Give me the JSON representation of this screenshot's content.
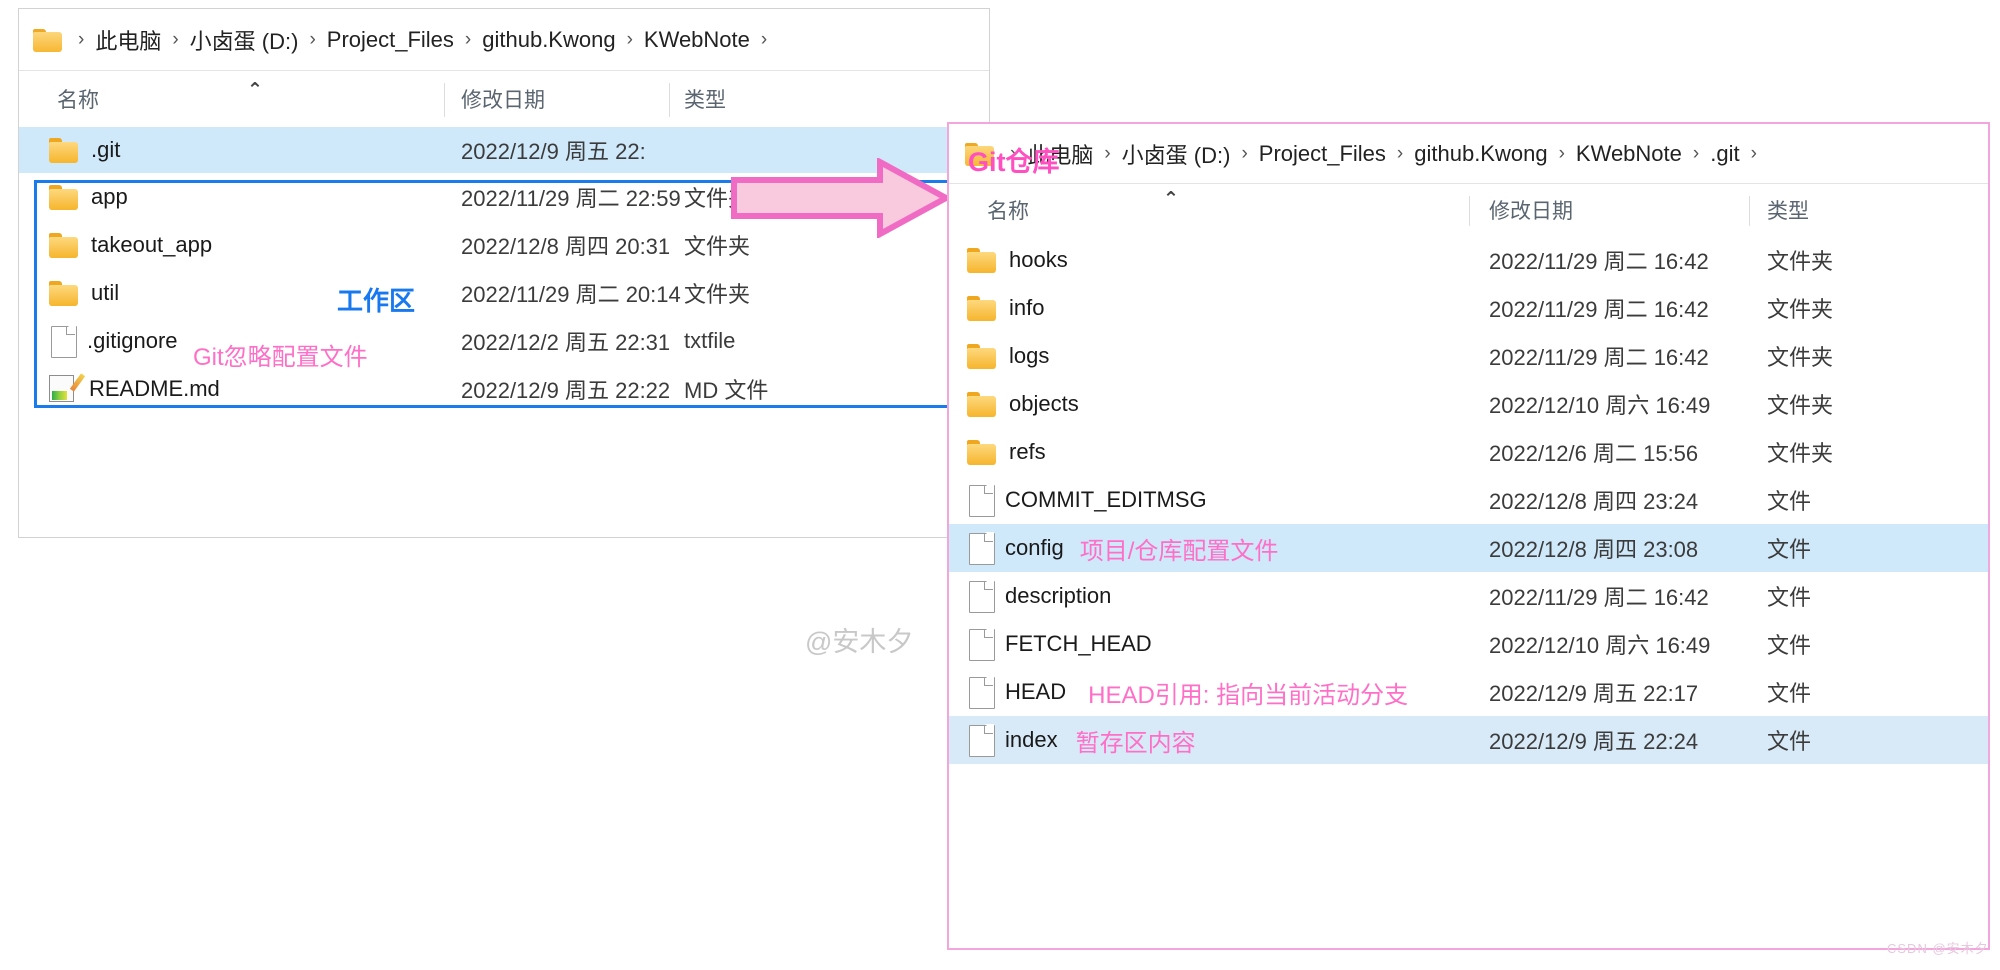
{
  "left_window": {
    "breadcrumb": {
      "folder_icon": "folder-icon",
      "items": [
        "此电脑",
        "小卤蛋 (D:)",
        "Project_Files",
        "github.Kwong",
        "KWebNote"
      ],
      "separator": "›",
      "trailing_separator": "›"
    },
    "columns": {
      "name": "名称",
      "date": "修改日期",
      "type": "类型",
      "sort_caret": "⌃"
    },
    "rows": [
      {
        "icon": "folder-icon",
        "name": ".git",
        "date": "2022/12/9 周五 22:",
        "type": "",
        "selected": true
      },
      {
        "icon": "folder-icon",
        "name": "app",
        "date": "2022/11/29 周二 22:59",
        "type": "文件夹",
        "selected": false
      },
      {
        "icon": "folder-icon",
        "name": "takeout_app",
        "date": "2022/12/8 周四 20:31",
        "type": "文件夹",
        "selected": false
      },
      {
        "icon": "folder-icon",
        "name": "util",
        "date": "2022/11/29 周二 20:14",
        "type": "文件夹",
        "selected": false
      },
      {
        "icon": "file-icon",
        "name": ".gitignore",
        "date": "2022/12/2 周五 22:31",
        "type": "txtfile",
        "selected": false
      },
      {
        "icon": "md-file-icon",
        "name": "README.md",
        "date": "2022/12/9 周五 22:22",
        "type": "MD 文件",
        "selected": false
      }
    ],
    "annotations": {
      "workspace": "工作区",
      "gitignore_note": "Git忽略配置文件"
    }
  },
  "right_window": {
    "breadcrumb": {
      "folder_icon": "folder-icon",
      "items": [
        "此电脑",
        "小卤蛋 (D:)",
        "Project_Files",
        "github.Kwong",
        "KWebNote",
        ".git"
      ],
      "separator": "›",
      "trailing_separator": "›"
    },
    "columns": {
      "name": "名称",
      "date": "修改日期",
      "type": "类型",
      "sort_caret": "⌃"
    },
    "rows": [
      {
        "icon": "folder-icon",
        "name": "hooks",
        "note": "",
        "date": "2022/11/29 周二 16:42",
        "type": "文件夹",
        "selected": false
      },
      {
        "icon": "folder-icon",
        "name": "info",
        "note": "",
        "date": "2022/11/29 周二 16:42",
        "type": "文件夹",
        "selected": false
      },
      {
        "icon": "folder-icon",
        "name": "logs",
        "note": "",
        "date": "2022/11/29 周二 16:42",
        "type": "文件夹",
        "selected": false
      },
      {
        "icon": "folder-icon",
        "name": "objects",
        "note": "",
        "date": "2022/12/10 周六 16:49",
        "type": "文件夹",
        "selected": false
      },
      {
        "icon": "folder-icon",
        "name": "refs",
        "note": "",
        "date": "2022/12/6 周二 15:56",
        "type": "文件夹",
        "selected": false
      },
      {
        "icon": "file-icon",
        "name": "COMMIT_EDITMSG",
        "note": "",
        "date": "2022/12/8 周四 23:24",
        "type": "文件",
        "selected": false
      },
      {
        "icon": "file-icon",
        "name": "config",
        "note": "项目/仓库配置文件",
        "date": "2022/12/8 周四 23:08",
        "type": "文件",
        "selected": true
      },
      {
        "icon": "file-icon",
        "name": "description",
        "note": "",
        "date": "2022/11/29 周二 16:42",
        "type": "文件",
        "selected": false
      },
      {
        "icon": "file-icon",
        "name": "FETCH_HEAD",
        "note": "",
        "date": "2022/12/10 周六 16:49",
        "type": "文件",
        "selected": false
      },
      {
        "icon": "file-icon",
        "name": "HEAD",
        "note": "HEAD引用: 指向当前活动分支",
        "date": "2022/12/9 周五 22:17",
        "type": "文件",
        "selected": false
      },
      {
        "icon": "file-icon",
        "name": "index",
        "note": "暂存区内容",
        "date": "2022/12/9 周五 22:24",
        "type": "文件",
        "selected": true
      }
    ],
    "annotations": {
      "git_repo": "Git仓库"
    }
  },
  "overlay": {
    "arrow": "right-arrow-annotation",
    "watermark": "@安木夕",
    "csdn_watermark": "CSDN @安木夕"
  },
  "colors": {
    "pink_annotation": "#ff6ec7",
    "pink_strong": "#ff4fc0",
    "blue_annotation": "#1878f0",
    "selection_blue": "#cfe8fa",
    "blue_box": "#1a7bec",
    "pink_border": "#f3a6dc",
    "folder_yellow": "#f6b52c"
  }
}
